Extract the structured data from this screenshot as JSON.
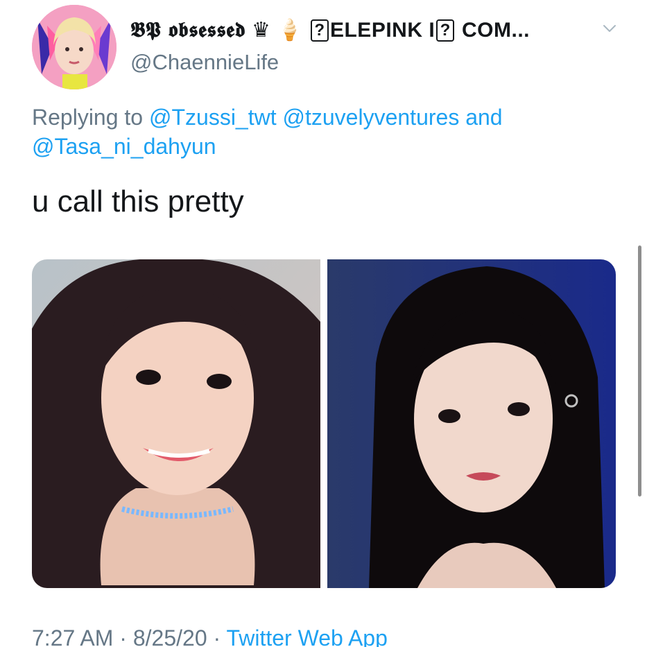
{
  "tweet": {
    "user": {
      "display_name_prefix": "𝕭𝕻 𝖔𝖇𝖘𝖊𝖘𝖘𝖊𝖉",
      "display_name_emoji": "♛ 🍦",
      "display_name_box1": "?",
      "display_name_middle": "ELEPINK I",
      "display_name_box2": "?",
      "display_name_suffix": " COM...",
      "handle": "@ChaennieLife",
      "avatar_icon": "profile-avatar"
    },
    "menu_icon": "chevron-down-icon",
    "reply": {
      "prefix": "Replying to",
      "mention_1": "@Tzussi_twt",
      "mention_2": "@tzuvelyventures",
      "conjunction": "and",
      "mention_3": "@Tasa_ni_dahyun"
    },
    "text": "u call this pretty",
    "media": [
      {
        "alt": "photo-1"
      },
      {
        "alt": "photo-2"
      }
    ],
    "meta": {
      "time": "7:27 AM",
      "separator_1": " · ",
      "date": "8/25/20",
      "separator_2": " · ",
      "source": "Twitter Web App"
    }
  },
  "colors": {
    "text": "#14171a",
    "secondary": "#657786",
    "link": "#1da1f2",
    "avatar_bg": "#f08fb8"
  }
}
